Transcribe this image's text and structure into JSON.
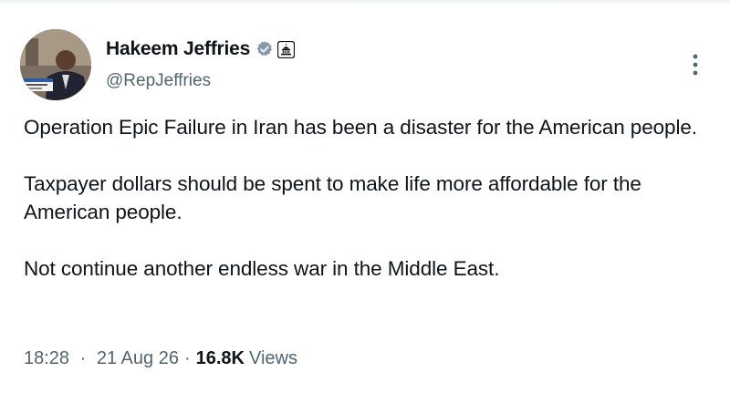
{
  "author": {
    "display_name": "Hakeem Jeffries",
    "handle": "@RepJeffries",
    "verified_icon": "verified-badge-icon",
    "affiliation_icon": "capitol-building-icon"
  },
  "tweet": {
    "paragraphs": [
      "Operation Epic Failure in Iran has been a disaster for the American people.",
      "Taxpayer dollars should be spent to make life more affordable for the American people.",
      "Not continue another endless war in the Middle East."
    ]
  },
  "meta": {
    "time": "18:28",
    "date": "21 Aug 26",
    "views_count": "16.8K",
    "views_label": "Views",
    "separator": "·"
  },
  "colors": {
    "text_primary": "#0f1419",
    "text_secondary": "#536471",
    "verified": "#829aab"
  }
}
